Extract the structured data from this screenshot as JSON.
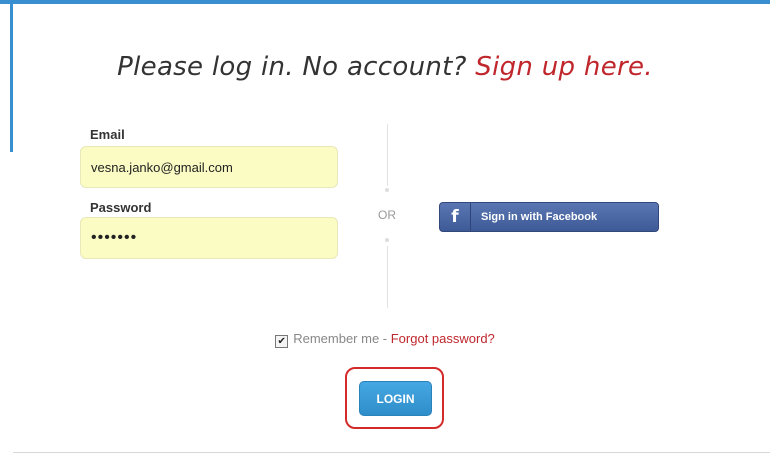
{
  "heading": {
    "prefix": "Please log in. No account? ",
    "signup_link": "Sign up here."
  },
  "form": {
    "email_label": "Email",
    "email_value": "vesna.janko@gmail.com",
    "password_label": "Password",
    "password_value": "•••••••"
  },
  "separator": {
    "or_text": "OR"
  },
  "facebook": {
    "icon": "f",
    "label": "Sign in with Facebook"
  },
  "remember": {
    "checked": true,
    "label": "Remember me",
    "separator": " - ",
    "forgot_link": "Forgot password?"
  },
  "login": {
    "label": "LOGIN"
  },
  "colors": {
    "accent_blue": "#3a8fd1",
    "link_red": "#c0272d",
    "input_bg": "#fbfbc4",
    "facebook_blue": "#3e5b98",
    "highlight_red": "#d42a2a"
  }
}
